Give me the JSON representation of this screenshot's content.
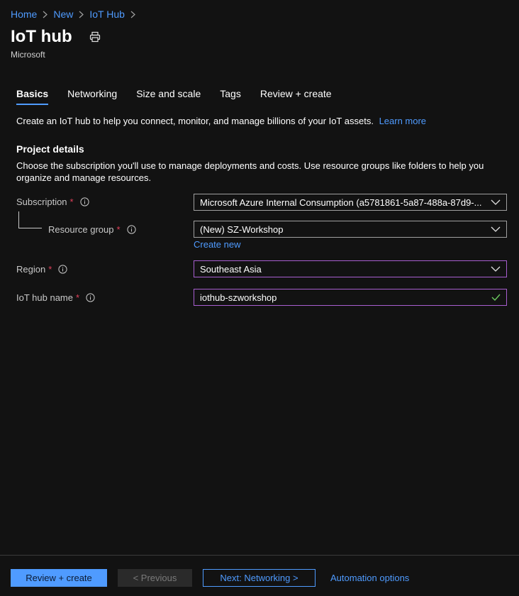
{
  "breadcrumb": {
    "items": [
      "Home",
      "New",
      "IoT Hub"
    ]
  },
  "page": {
    "title": "IoT hub",
    "subtitle": "Microsoft"
  },
  "tabs": [
    {
      "label": "Basics",
      "active": true
    },
    {
      "label": "Networking",
      "active": false
    },
    {
      "label": "Size and scale",
      "active": false
    },
    {
      "label": "Tags",
      "active": false
    },
    {
      "label": "Review + create",
      "active": false
    }
  ],
  "intro": {
    "text": "Create an IoT hub to help you connect, monitor, and manage billions of your IoT assets.",
    "link": "Learn more"
  },
  "project_details": {
    "title": "Project details",
    "description": "Choose the subscription you'll use to manage deployments and costs. Use resource groups like folders to help you organize and manage resources."
  },
  "form": {
    "subscription": {
      "label": "Subscription",
      "value": "Microsoft Azure Internal Consumption (a5781861-5a87-488a-87d9-..."
    },
    "resource_group": {
      "label": "Resource group",
      "value": "(New) SZ-Workshop",
      "create_new": "Create new"
    },
    "region": {
      "label": "Region",
      "value": "Southeast Asia"
    },
    "iot_hub_name": {
      "label": "IoT hub name",
      "value": "iothub-szworkshop"
    },
    "required_marker": "*"
  },
  "footer": {
    "review_create": "Review + create",
    "previous": "< Previous",
    "next": "Next: Networking >",
    "automation": "Automation options"
  },
  "colors": {
    "background": "#121212",
    "accent": "#4f9bff",
    "required": "#e0405a",
    "focus_border": "#a85fd0",
    "valid_check": "#6ccb5f"
  }
}
